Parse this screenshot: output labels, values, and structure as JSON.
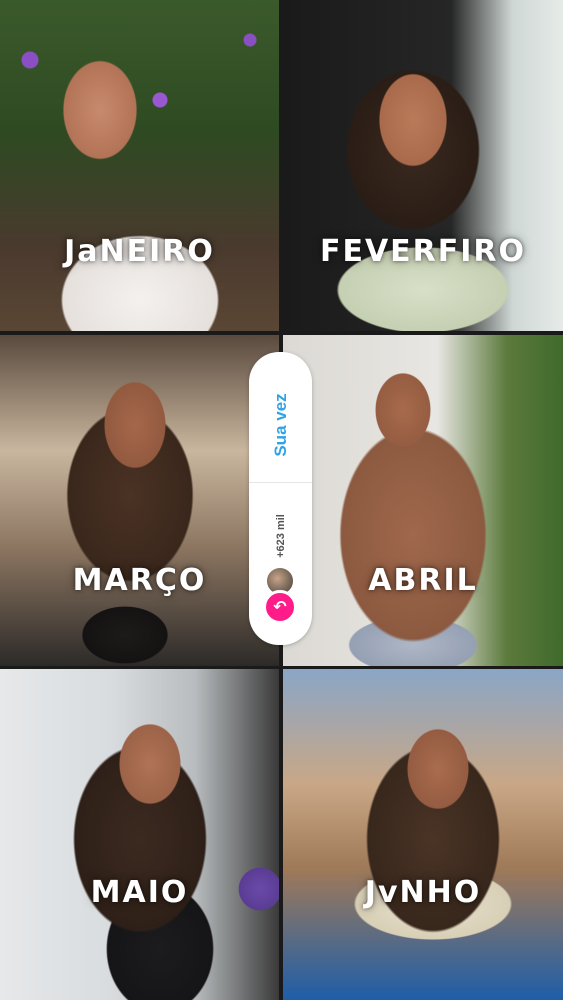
{
  "tiles": [
    {
      "month": "JaNEIRO"
    },
    {
      "month": "FEVERFIRO"
    },
    {
      "month": "MARÇO"
    },
    {
      "month": "ABRIL"
    },
    {
      "month": "MAIO"
    },
    {
      "month": "JvNHO"
    }
  ],
  "sticker": {
    "title": "Sua vez",
    "count": "+623 mil",
    "reply_icon": "reply-arrow-icon",
    "colors": {
      "title": "#2fa2e8",
      "reply_button": "#ff1b8a",
      "background": "#ffffff"
    }
  }
}
